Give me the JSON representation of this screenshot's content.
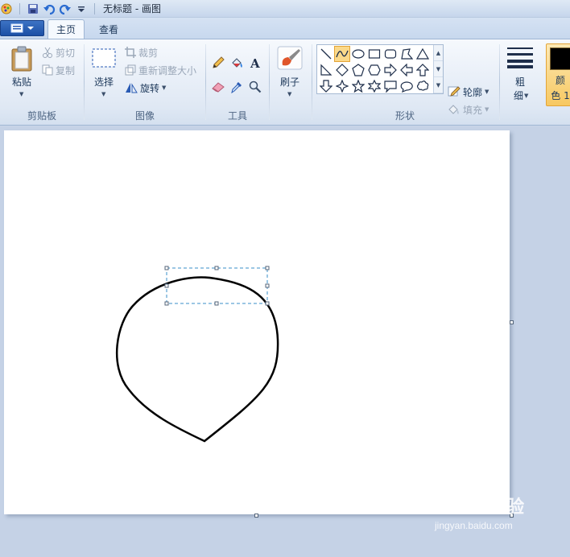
{
  "window": {
    "title": "无标题 - 画图"
  },
  "tabs": [
    {
      "label": "主页",
      "active": true
    },
    {
      "label": "查看",
      "active": false
    }
  ],
  "clipboard": {
    "paste_label": "粘贴",
    "cut_label": "剪切",
    "copy_label": "复制",
    "group_label": "剪贴板"
  },
  "image": {
    "select_label": "选择",
    "crop_label": "裁剪",
    "resize_label": "重新调整大小",
    "rotate_label": "旋转",
    "group_label": "图像"
  },
  "tools": {
    "group_label": "工具"
  },
  "brushes": {
    "label": "刷子"
  },
  "shapes": {
    "group_label": "形状",
    "outline_label": "轮廓",
    "fill_label": "填充",
    "selected_shape": "curve"
  },
  "size": {
    "label_line1": "粗",
    "label_line2": "细"
  },
  "colors": {
    "label_line1": "颜",
    "label_line2": "色 1",
    "color1": "#000000"
  },
  "watermark": {
    "main": "Baidu经验",
    "sub": "jingyan.baidu.com"
  }
}
